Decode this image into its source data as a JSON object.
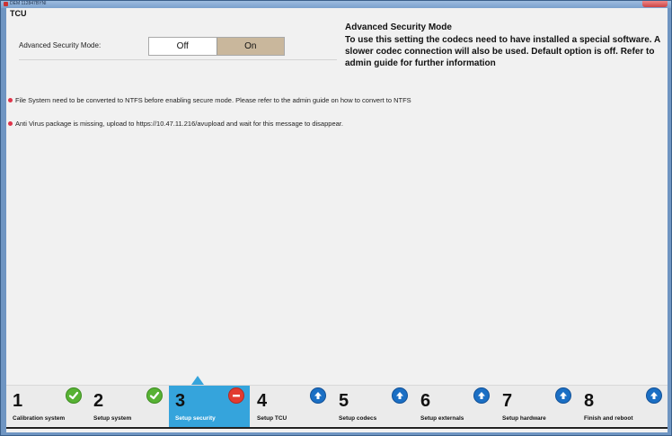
{
  "window": {
    "title": "DEM 112847BYNI",
    "colors": {
      "frame": "#6f95c2",
      "accent": "#35a4dc",
      "error": "#e0344a"
    }
  },
  "tcu": {
    "heading": "TCU",
    "mode_label": "Advanced Security Mode:",
    "off_label": "Off",
    "on_label": "On",
    "selected": "On"
  },
  "info": {
    "title": "Advanced Security Mode",
    "body": "To use this setting the codecs need to have installed a special software. A slower codec connection will also be used. Default option is off. Refer to admin guide for further information"
  },
  "messages": [
    {
      "text": "File System need to be converted to NTFS before enabling secure mode. Please refer to the admin guide on how to convert to NTFS",
      "icon": "error-dot-icon"
    },
    {
      "text": "Anti Virus package is missing, upload to https://10.47.11.216/avupload and wait for this message to disappear.",
      "icon": "error-dot-icon"
    }
  ],
  "steps": [
    {
      "num": "1",
      "label": "Calibration system",
      "status": "done",
      "icon": "check-icon"
    },
    {
      "num": "2",
      "label": "Setup system",
      "status": "done",
      "icon": "check-icon"
    },
    {
      "num": "3",
      "label": "Setup security",
      "status": "error",
      "icon": "stop-icon",
      "active": true
    },
    {
      "num": "4",
      "label": "Setup TCU",
      "status": "pending",
      "icon": "arrow-up-icon"
    },
    {
      "num": "5",
      "label": "Setup codecs",
      "status": "pending",
      "icon": "arrow-up-icon"
    },
    {
      "num": "6",
      "label": "Setup externals",
      "status": "pending",
      "icon": "arrow-up-icon"
    },
    {
      "num": "7",
      "label": "Setup hardware",
      "status": "pending",
      "icon": "arrow-up-icon"
    },
    {
      "num": "8",
      "label": "Finish and reboot",
      "status": "pending",
      "icon": "arrow-up-icon"
    }
  ]
}
